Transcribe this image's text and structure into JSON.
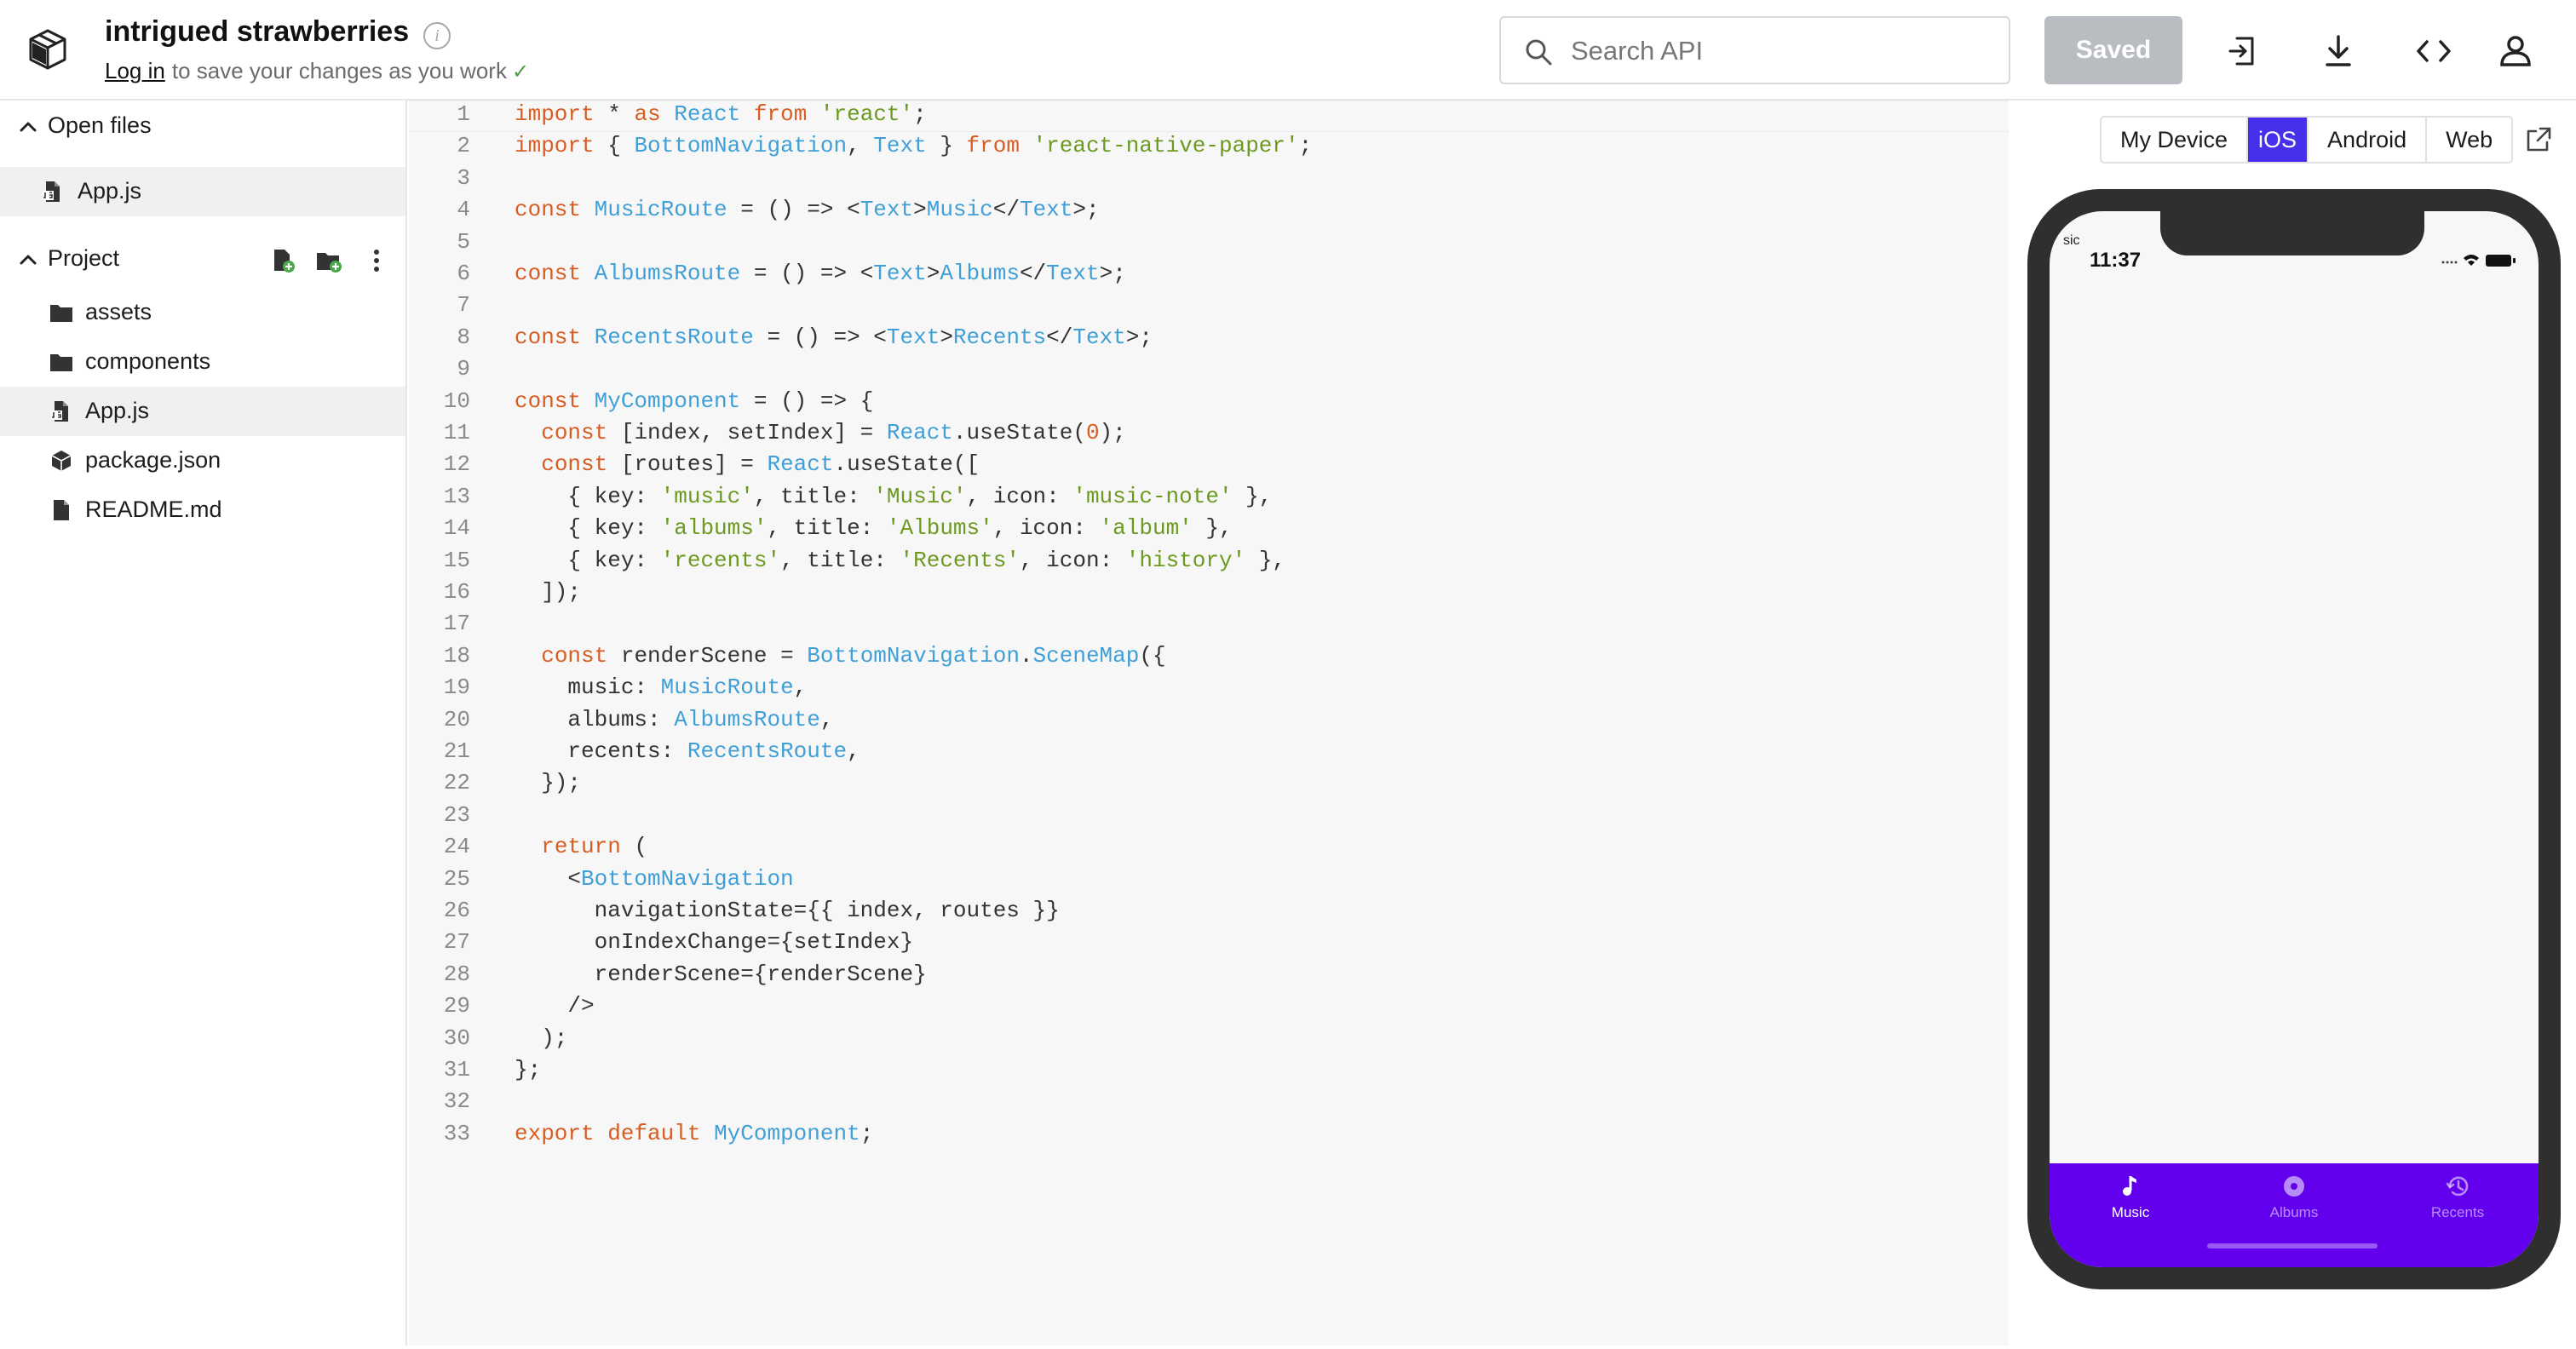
{
  "header": {
    "title": "intrigued strawberries",
    "info_icon_glyph": "i",
    "login_link": "Log in",
    "login_suffix": "to save your changes as you work",
    "check_glyph": "✓",
    "search_placeholder": "Search API",
    "saved_label": "Saved",
    "icons": [
      "logo-icon",
      "info-icon",
      "search-icon",
      "export-icon",
      "download-icon",
      "embed-code-icon",
      "user-icon"
    ]
  },
  "sidebar": {
    "open_files_label": "Open files",
    "open_files": [
      {
        "label": "App.js",
        "icon": "js-file-icon"
      }
    ],
    "project_label": "Project",
    "project_items": [
      {
        "label": "assets",
        "icon": "folder-icon"
      },
      {
        "label": "components",
        "icon": "folder-icon"
      },
      {
        "label": "App.js",
        "icon": "js-file-icon"
      },
      {
        "label": "package.json",
        "icon": "package-icon"
      },
      {
        "label": "README.md",
        "icon": "file-icon"
      }
    ]
  },
  "editor": {
    "lines": [
      [
        [
          "kw",
          "import"
        ],
        [
          "p",
          " * "
        ],
        [
          "kw",
          "as"
        ],
        [
          "p",
          " "
        ],
        [
          "id",
          "React"
        ],
        [
          "p",
          " "
        ],
        [
          "kw",
          "from"
        ],
        [
          "p",
          " "
        ],
        [
          "str",
          "'react'"
        ],
        [
          "p",
          ";"
        ]
      ],
      [
        [
          "kw",
          "import"
        ],
        [
          "p",
          " { "
        ],
        [
          "id",
          "BottomNavigation"
        ],
        [
          "p",
          ", "
        ],
        [
          "id",
          "Text"
        ],
        [
          "p",
          " } "
        ],
        [
          "kw",
          "from"
        ],
        [
          "p",
          " "
        ],
        [
          "str",
          "'react-native-paper'"
        ],
        [
          "p",
          ";"
        ]
      ],
      [],
      [
        [
          "kw",
          "const"
        ],
        [
          "p",
          " "
        ],
        [
          "id",
          "MusicRoute"
        ],
        [
          "p",
          " = () => <"
        ],
        [
          "id",
          "Text"
        ],
        [
          "p",
          ">"
        ],
        [
          "id",
          "Music"
        ],
        [
          "p",
          "</"
        ],
        [
          "id",
          "Text"
        ],
        [
          "p",
          ">;"
        ]
      ],
      [],
      [
        [
          "kw",
          "const"
        ],
        [
          "p",
          " "
        ],
        [
          "id",
          "AlbumsRoute"
        ],
        [
          "p",
          " = () => <"
        ],
        [
          "id",
          "Text"
        ],
        [
          "p",
          ">"
        ],
        [
          "id",
          "Albums"
        ],
        [
          "p",
          "</"
        ],
        [
          "id",
          "Text"
        ],
        [
          "p",
          ">;"
        ]
      ],
      [],
      [
        [
          "kw",
          "const"
        ],
        [
          "p",
          " "
        ],
        [
          "id",
          "RecentsRoute"
        ],
        [
          "p",
          " = () => <"
        ],
        [
          "id",
          "Text"
        ],
        [
          "p",
          ">"
        ],
        [
          "id",
          "Recents"
        ],
        [
          "p",
          "</"
        ],
        [
          "id",
          "Text"
        ],
        [
          "p",
          ">;"
        ]
      ],
      [],
      [
        [
          "kw",
          "const"
        ],
        [
          "p",
          " "
        ],
        [
          "id",
          "MyComponent"
        ],
        [
          "p",
          " = () => {"
        ]
      ],
      [
        [
          "p",
          "  "
        ],
        [
          "kw",
          "const"
        ],
        [
          "p",
          " [index, setIndex] = "
        ],
        [
          "id",
          "React"
        ],
        [
          "p",
          ".useState("
        ],
        [
          "num",
          "0"
        ],
        [
          "p",
          ");"
        ]
      ],
      [
        [
          "p",
          "  "
        ],
        [
          "kw",
          "const"
        ],
        [
          "p",
          " [routes] = "
        ],
        [
          "id",
          "React"
        ],
        [
          "p",
          ".useState(["
        ]
      ],
      [
        [
          "p",
          "    { key: "
        ],
        [
          "str",
          "'music'"
        ],
        [
          "p",
          ", title: "
        ],
        [
          "str",
          "'Music'"
        ],
        [
          "p",
          ", icon: "
        ],
        [
          "str",
          "'music-note'"
        ],
        [
          "p",
          " },"
        ]
      ],
      [
        [
          "p",
          "    { key: "
        ],
        [
          "str",
          "'albums'"
        ],
        [
          "p",
          ", title: "
        ],
        [
          "str",
          "'Albums'"
        ],
        [
          "p",
          ", icon: "
        ],
        [
          "str",
          "'album'"
        ],
        [
          "p",
          " },"
        ]
      ],
      [
        [
          "p",
          "    { key: "
        ],
        [
          "str",
          "'recents'"
        ],
        [
          "p",
          ", title: "
        ],
        [
          "str",
          "'Recents'"
        ],
        [
          "p",
          ", icon: "
        ],
        [
          "str",
          "'history'"
        ],
        [
          "p",
          " },"
        ]
      ],
      [
        [
          "p",
          "  ]);"
        ]
      ],
      [],
      [
        [
          "p",
          "  "
        ],
        [
          "kw",
          "const"
        ],
        [
          "p",
          " renderScene = "
        ],
        [
          "id",
          "BottomNavigation"
        ],
        [
          "p",
          "."
        ],
        [
          "id",
          "SceneMap"
        ],
        [
          "p",
          "({"
        ]
      ],
      [
        [
          "p",
          "    music: "
        ],
        [
          "id",
          "MusicRoute"
        ],
        [
          "p",
          ","
        ]
      ],
      [
        [
          "p",
          "    albums: "
        ],
        [
          "id",
          "AlbumsRoute"
        ],
        [
          "p",
          ","
        ]
      ],
      [
        [
          "p",
          "    recents: "
        ],
        [
          "id",
          "RecentsRoute"
        ],
        [
          "p",
          ","
        ]
      ],
      [
        [
          "p",
          "  });"
        ]
      ],
      [],
      [
        [
          "p",
          "  "
        ],
        [
          "kw",
          "return"
        ],
        [
          "p",
          " ("
        ]
      ],
      [
        [
          "p",
          "    <"
        ],
        [
          "id",
          "BottomNavigation"
        ]
      ],
      [
        [
          "p",
          "      navigationState={{ index, routes }}"
        ]
      ],
      [
        [
          "p",
          "      onIndexChange={setIndex}"
        ]
      ],
      [
        [
          "p",
          "      renderScene={renderScene}"
        ]
      ],
      [
        [
          "p",
          "    />"
        ]
      ],
      [
        [
          "p",
          "  );"
        ]
      ],
      [
        [
          "p",
          "};"
        ]
      ],
      [],
      [
        [
          "kw",
          "export"
        ],
        [
          "p",
          " "
        ],
        [
          "kw",
          "default"
        ],
        [
          "p",
          " "
        ],
        [
          "id",
          "MyComponent"
        ],
        [
          "p",
          ";"
        ]
      ]
    ]
  },
  "preview": {
    "platforms": [
      "My Device",
      "iOS",
      "Android",
      "Web"
    ],
    "active_platform": "iOS",
    "status_time": "11:37",
    "status_tiny": "sic",
    "tabs": [
      {
        "label": "Music",
        "icon": "music-note-icon",
        "active": true
      },
      {
        "label": "Albums",
        "icon": "album-icon",
        "active": false
      },
      {
        "label": "Recents",
        "icon": "history-icon",
        "active": false
      }
    ],
    "colors": {
      "tabbar": "#6200ee",
      "accent": "#4630eb",
      "keyword": "#d75d23",
      "string": "#6b9a1f",
      "identifier": "#3f9fd6"
    }
  }
}
